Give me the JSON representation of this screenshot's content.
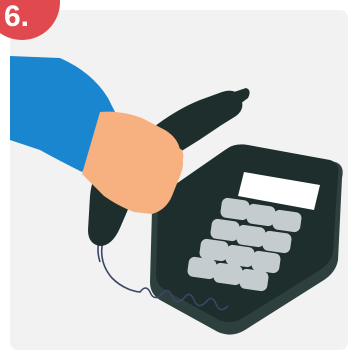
{
  "badge": {
    "label": "6."
  },
  "colors": {
    "background_panel": "#f2f2f2",
    "badge": "#e04a4f",
    "sleeve": "#1a86cf",
    "skin": "#f7b07f",
    "phone_body": "#1e2e2c",
    "phone_body_edge": "#2d403d",
    "keys": "#c5ccd0",
    "screen": "#ffffff",
    "cord": "#3b4566"
  },
  "icons": {
    "illustration": "hand-holding-phone-receiver"
  }
}
